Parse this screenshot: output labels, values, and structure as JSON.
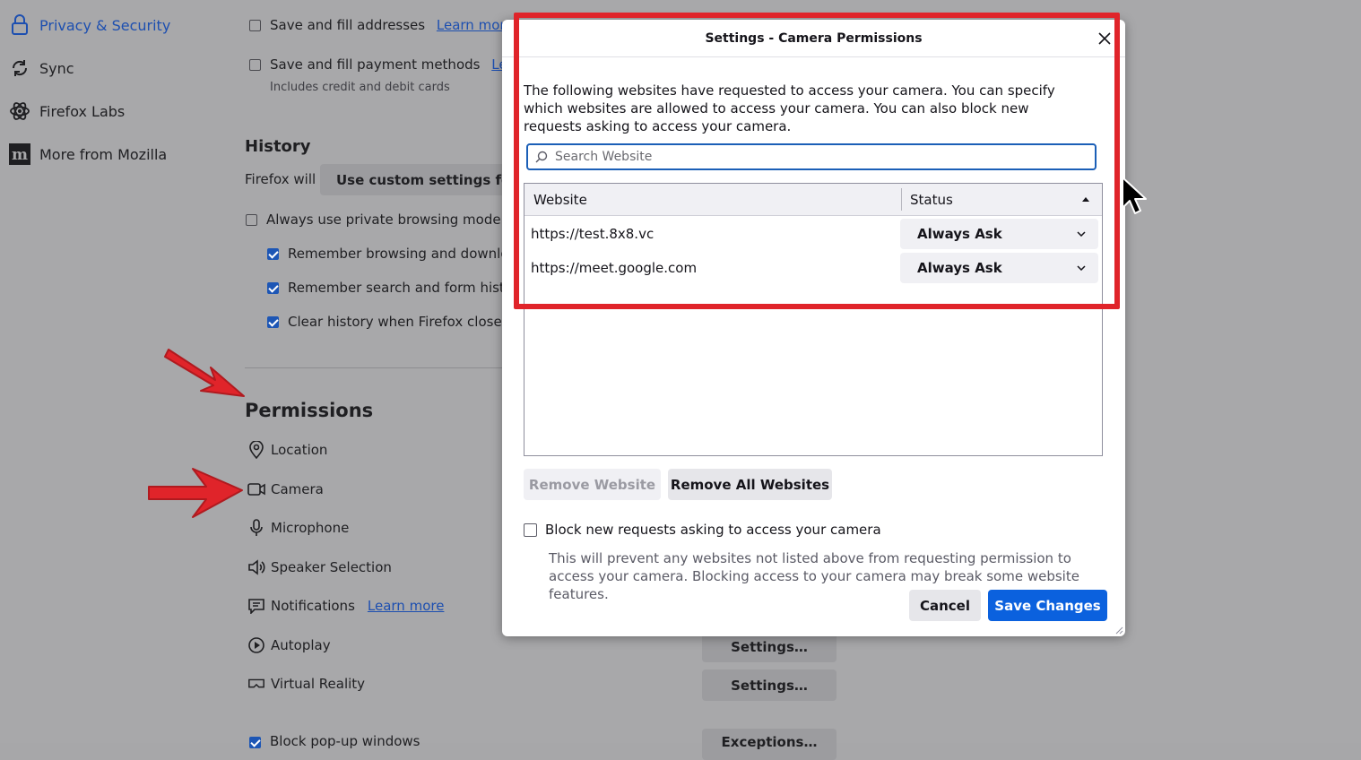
{
  "sidebar": {
    "items": [
      {
        "label": "Privacy & Security",
        "icon": "lock-icon",
        "active": true
      },
      {
        "label": "Sync",
        "icon": "sync-icon"
      },
      {
        "label": "Firefox Labs",
        "icon": "labs-icon"
      },
      {
        "label": "More from Mozilla",
        "icon": "mozilla-icon"
      }
    ]
  },
  "forms": {
    "save_addresses": "Save and fill addresses",
    "save_addresses_link": "Learn more",
    "save_payment": "Save and fill payment methods",
    "save_payment_link": "Learn",
    "payment_sub": "Includes credit and debit cards"
  },
  "history": {
    "heading": "History",
    "firefox_will_label": "Firefox will",
    "select_value": "Use custom settings for h",
    "private_mode": "Always use private browsing mode",
    "remember_browsing": "Remember browsing and downloa",
    "remember_search": "Remember search and form histor",
    "clear_history": "Clear history when Firefox closes"
  },
  "permissions": {
    "heading": "Permissions",
    "items": [
      {
        "label": "Location",
        "icon": "location-icon"
      },
      {
        "label": "Camera",
        "icon": "camera-icon"
      },
      {
        "label": "Microphone",
        "icon": "microphone-icon"
      },
      {
        "label": "Speaker Selection",
        "icon": "speaker-icon"
      },
      {
        "label": "Notifications",
        "icon": "notification-icon",
        "link": "Learn more"
      },
      {
        "label": "Autoplay",
        "icon": "autoplay-icon"
      },
      {
        "label": "Virtual Reality",
        "icon": "vr-icon"
      }
    ],
    "settings_button": "Settings…",
    "exceptions_button": "Exceptions…",
    "block_popups_partial": "Block pop-up windows"
  },
  "dialog": {
    "title": "Settings - Camera Permissions",
    "description": "The following websites have requested to access your camera. You can specify which websites are allowed to access your camera. You can also block new requests asking to access your camera.",
    "search_placeholder": "Search Website",
    "columns": {
      "website": "Website",
      "status": "Status"
    },
    "rows": [
      {
        "website": "https://test.8x8.vc",
        "status": "Always Ask"
      },
      {
        "website": "https://meet.google.com",
        "status": "Always Ask"
      }
    ],
    "remove_website": "Remove Website",
    "remove_all": "Remove All Websites",
    "block_label": "Block new requests asking to access your camera",
    "block_desc": "This will prevent any websites not listed above from requesting permission to access your camera. Blocking access to your camera may break some website features.",
    "cancel": "Cancel",
    "save": "Save Changes"
  },
  "colors": {
    "accent": "#0b61de",
    "annotation": "#e0242a",
    "overlay": "#a8a8aa"
  }
}
